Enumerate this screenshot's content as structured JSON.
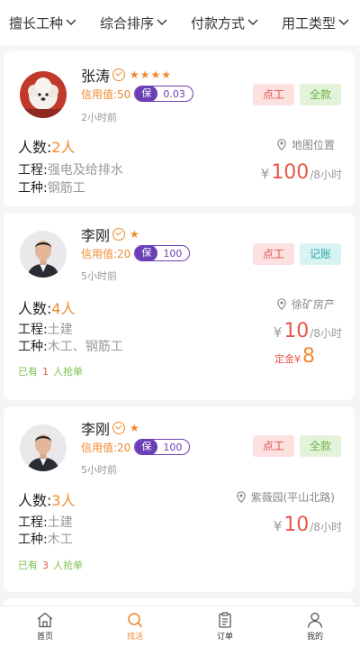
{
  "filters": [
    "擅长工种",
    "综合排序",
    "付款方式",
    "用工类型"
  ],
  "cards": [
    {
      "name": "张涛",
      "stars": "★★★★",
      "credit": "信用值:50",
      "bao_label": "保",
      "bao_value": "0.03",
      "time": "2小时前",
      "tags": [
        "点工",
        "全款"
      ],
      "count_label": "人数:",
      "count": "2人",
      "project_label": "工程:",
      "project": "强电及给排水",
      "trade_label": "工种:",
      "trade": "钢筋工",
      "location": "地图位置",
      "yen": "¥",
      "price": "100",
      "unit": "/8小时"
    },
    {
      "name": "李刚",
      "stars": "★",
      "credit": "信用值:20",
      "bao_label": "保",
      "bao_value": "100",
      "time": "5小时前",
      "tags": [
        "点工",
        "记账"
      ],
      "count_label": "人数:",
      "count": "4人",
      "project_label": "工程:",
      "project": "土建",
      "trade_label": "工种:",
      "trade": "木工、钢筋工",
      "location": "徐矿房产",
      "yen": "¥",
      "price": "10",
      "unit": "/8小时",
      "deposit_label": "定金¥",
      "deposit": "8",
      "grab_prefix": "已有",
      "grab_count": "1",
      "grab_suffix": "人抢单"
    },
    {
      "name": "李刚",
      "stars": "★",
      "credit": "信用值:20",
      "bao_label": "保",
      "bao_value": "100",
      "time": "5小时前",
      "tags": [
        "点工",
        "全款"
      ],
      "count_label": "人数:",
      "count": "3人",
      "project_label": "工程:",
      "project": "土建",
      "trade_label": "工种:",
      "trade": "木工",
      "location": "紫薇园(平山北路)",
      "yen": "¥",
      "price": "10",
      "unit": "/8小时",
      "grab_prefix": "已有",
      "grab_count": "3",
      "grab_suffix": "人抢单"
    }
  ],
  "tabs": [
    "首页",
    "找活",
    "订单",
    "我的"
  ],
  "colors": {
    "accent": "#f08a2d",
    "price": "#e8564a",
    "purple": "#6a3fb5",
    "green": "#7cc04f"
  }
}
